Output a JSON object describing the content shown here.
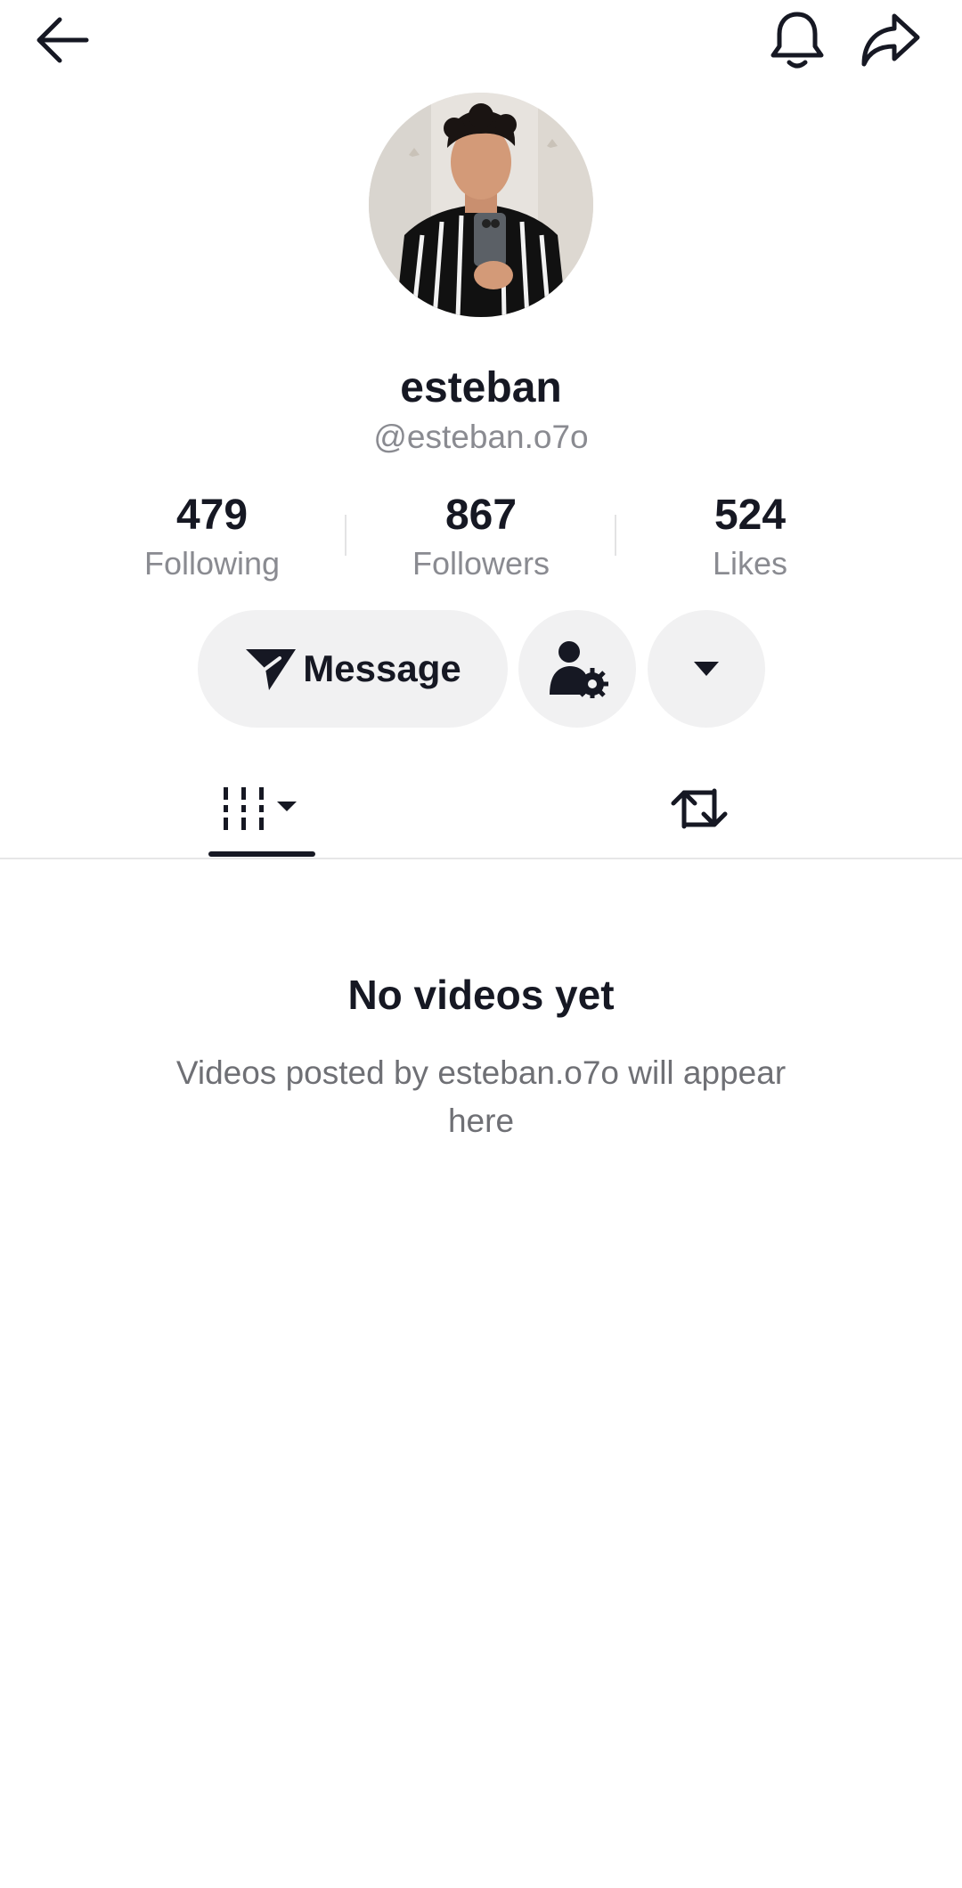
{
  "profile": {
    "display_name": "esteban",
    "handle": "@esteban.o7o"
  },
  "stats": [
    {
      "value": "479",
      "label": "Following"
    },
    {
      "value": "867",
      "label": "Followers"
    },
    {
      "value": "524",
      "label": "Likes"
    }
  ],
  "actions": {
    "message_label": "Message"
  },
  "tabs": {
    "videos_icon": "grid-icon",
    "reposts_icon": "repost-icon"
  },
  "empty_state": {
    "title": "No videos yet",
    "subtitle": "Videos posted by esteban.o7o will appear here"
  },
  "colors": {
    "text_primary": "#161823",
    "text_secondary": "#8a8b91",
    "button_bg": "#f1f1f2"
  }
}
